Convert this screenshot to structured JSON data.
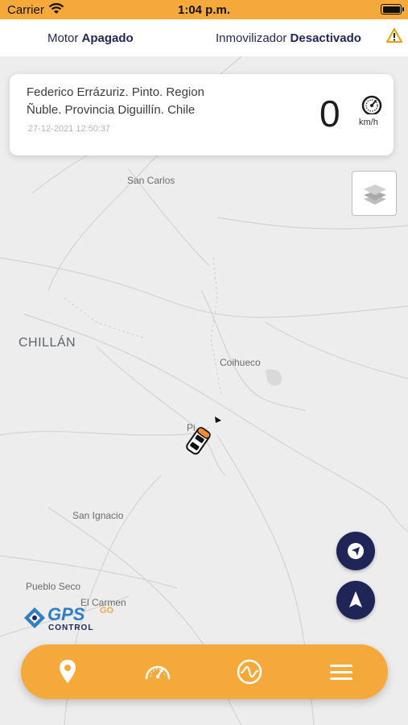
{
  "status_bar": {
    "carrier": "Carrier",
    "time": "1:04 p.m."
  },
  "info_bar": {
    "motor_label": "Motor",
    "motor_value": "Apagado",
    "immobilizer_label": "Inmovilizador",
    "immobilizer_value": "Desactivado",
    "warning_icon": "warning-icon"
  },
  "card": {
    "address": "Federico Errázuriz. Pinto. Region Ñuble. Provincia Diguillín. Chile",
    "datetime": "27-12-2021 12:50:37",
    "speed": "0",
    "speed_unit": "km/h"
  },
  "map": {
    "places": [
      {
        "name": "San Carlos"
      },
      {
        "name": "CHILLÁN"
      },
      {
        "name": "Coihueco"
      },
      {
        "name": "Pi"
      },
      {
        "name": "San Ignacio"
      },
      {
        "name": "Pueblo Seco"
      },
      {
        "name": "El Carmen"
      }
    ]
  },
  "logo": {
    "text": "GPS",
    "subtext": "CONTROL",
    "badge": "GO"
  },
  "bottom_nav": {
    "items": [
      "location-icon",
      "speedometer-icon",
      "signal-icon",
      "menu-icon"
    ]
  },
  "colors": {
    "accent": "#f5a93a",
    "navy": "#1f2657"
  }
}
